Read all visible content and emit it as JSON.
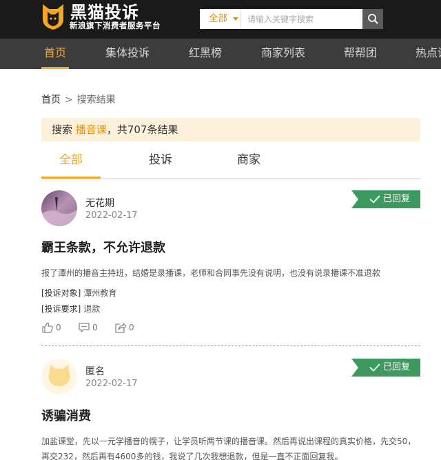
{
  "brand": {
    "name": "黑猫投诉",
    "slogan": "新浪旗下消费者服务平台"
  },
  "search": {
    "scope": "全部",
    "placeholder": "请输入关键字搜索"
  },
  "nav": {
    "items": [
      {
        "label": "首页"
      },
      {
        "label": "集体投诉"
      },
      {
        "label": "红黑榜"
      },
      {
        "label": "商家列表"
      },
      {
        "label": "帮帮团"
      },
      {
        "label": "热点调"
      }
    ]
  },
  "breadcrumb": {
    "home": "首页",
    "separator": ">",
    "current": "搜索结果"
  },
  "result": {
    "prefix": "搜索",
    "keyword": "播音课",
    "suffix": "，共707条结果"
  },
  "tabs": [
    {
      "label": "全部"
    },
    {
      "label": "投诉"
    },
    {
      "label": "商家"
    }
  ],
  "complaints": [
    {
      "user": "无花期",
      "date": "2022-02-17",
      "status": "已回复",
      "title": "霸王条款，不允许退款",
      "description": "报了潭州的播音主持班，结婚是录播课，老师和合同事先没有说明，也没有说录播课不准退款",
      "target_label": "[投诉对象]",
      "target": "潭州教育",
      "demand_label": "[投诉要求]",
      "demand": "退款",
      "likes": "0",
      "comments": "0",
      "shares": "0"
    },
    {
      "user": "匿名",
      "date": "2022-02-17",
      "status": "已回复",
      "title": "诱骗消费",
      "description": "加盐课堂，先以一元学播音的幌子，让学员听两节课的播音课。然后再说出课程的真实价格，先交50，再交232，然后再有4600多的钱，我说了几次我想退款，但是一直不正面回复我。"
    }
  ],
  "colors": {
    "accent": "#f5a623",
    "keyword": "#f08c00",
    "header_bg": "#1a1a1a",
    "nav_bg": "#3c3c3c",
    "banner_bg": "#fdf1dc",
    "badge": "#3c9a5f"
  },
  "icons": {
    "logo": "black-cat-shield-icon",
    "search": "magnifier-icon",
    "replied": "check-icon",
    "like": "thumbs-up-icon",
    "comment": "speech-bubble-icon",
    "share": "share-icon",
    "anonymous_avatar": "cat-face-icon"
  }
}
